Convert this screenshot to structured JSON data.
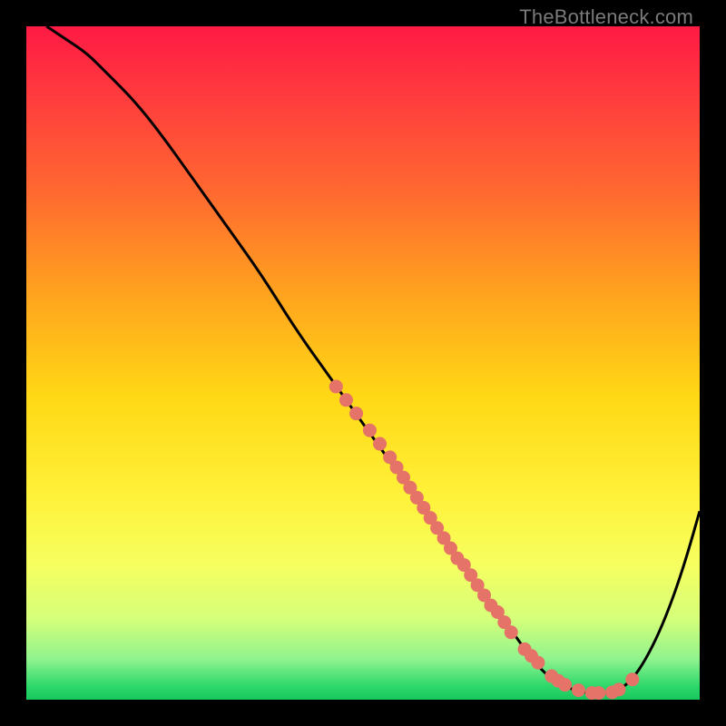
{
  "attribution": "TheBottleneck.com",
  "colors": {
    "curve": "#000000",
    "points": "#e57368"
  },
  "chart_data": {
    "type": "line",
    "title": "",
    "xlabel": "",
    "ylabel": "",
    "xlim": [
      0,
      100
    ],
    "ylim": [
      0,
      100
    ],
    "grid": false,
    "legend": false,
    "series": [
      {
        "name": "bottleneck-curve",
        "x": [
          3,
          6,
          9,
          12,
          16,
          20,
          25,
          30,
          35,
          40,
          45,
          50,
          55,
          60,
          65,
          70,
          73,
          75,
          78,
          80,
          82,
          84,
          86,
          88,
          90,
          92,
          94,
          96,
          98,
          100
        ],
        "y": [
          100,
          98,
          96,
          93,
          89,
          84,
          77,
          70,
          63,
          55,
          48,
          41,
          34,
          27,
          20,
          13,
          9,
          6,
          3,
          2,
          1.2,
          1,
          1,
          1.4,
          3,
          6,
          10,
          15,
          21,
          28
        ]
      }
    ],
    "points": {
      "name": "sample-dots",
      "x": [
        46,
        47.5,
        49,
        51,
        52.5,
        54,
        55,
        56,
        57,
        58,
        59,
        60,
        61,
        62,
        63,
        64,
        65,
        66,
        67,
        68,
        69,
        70,
        71,
        72,
        74,
        75,
        76,
        78,
        79,
        80,
        82,
        84,
        85,
        87,
        88,
        90
      ],
      "y": [
        46.5,
        44.5,
        42.5,
        40,
        38,
        36,
        34.5,
        33,
        31.5,
        30,
        28.5,
        27,
        25.5,
        24,
        22.5,
        21,
        20,
        18.5,
        17,
        15.5,
        14,
        13,
        11.5,
        10,
        7.5,
        6.5,
        5.5,
        3.5,
        2.8,
        2.2,
        1.4,
        1,
        1,
        1.1,
        1.5,
        3
      ]
    },
    "background_gradient_stops": [
      {
        "pos": 0.0,
        "color": "#ff1a44"
      },
      {
        "pos": 0.1,
        "color": "#ff3a3e"
      },
      {
        "pos": 0.25,
        "color": "#ff6a30"
      },
      {
        "pos": 0.4,
        "color": "#ffa41e"
      },
      {
        "pos": 0.55,
        "color": "#ffd815"
      },
      {
        "pos": 0.7,
        "color": "#fff23a"
      },
      {
        "pos": 0.8,
        "color": "#f6ff60"
      },
      {
        "pos": 0.88,
        "color": "#d5ff7a"
      },
      {
        "pos": 0.94,
        "color": "#8ff38e"
      },
      {
        "pos": 0.98,
        "color": "#2dd86b"
      },
      {
        "pos": 1.0,
        "color": "#18c85d"
      }
    ]
  }
}
